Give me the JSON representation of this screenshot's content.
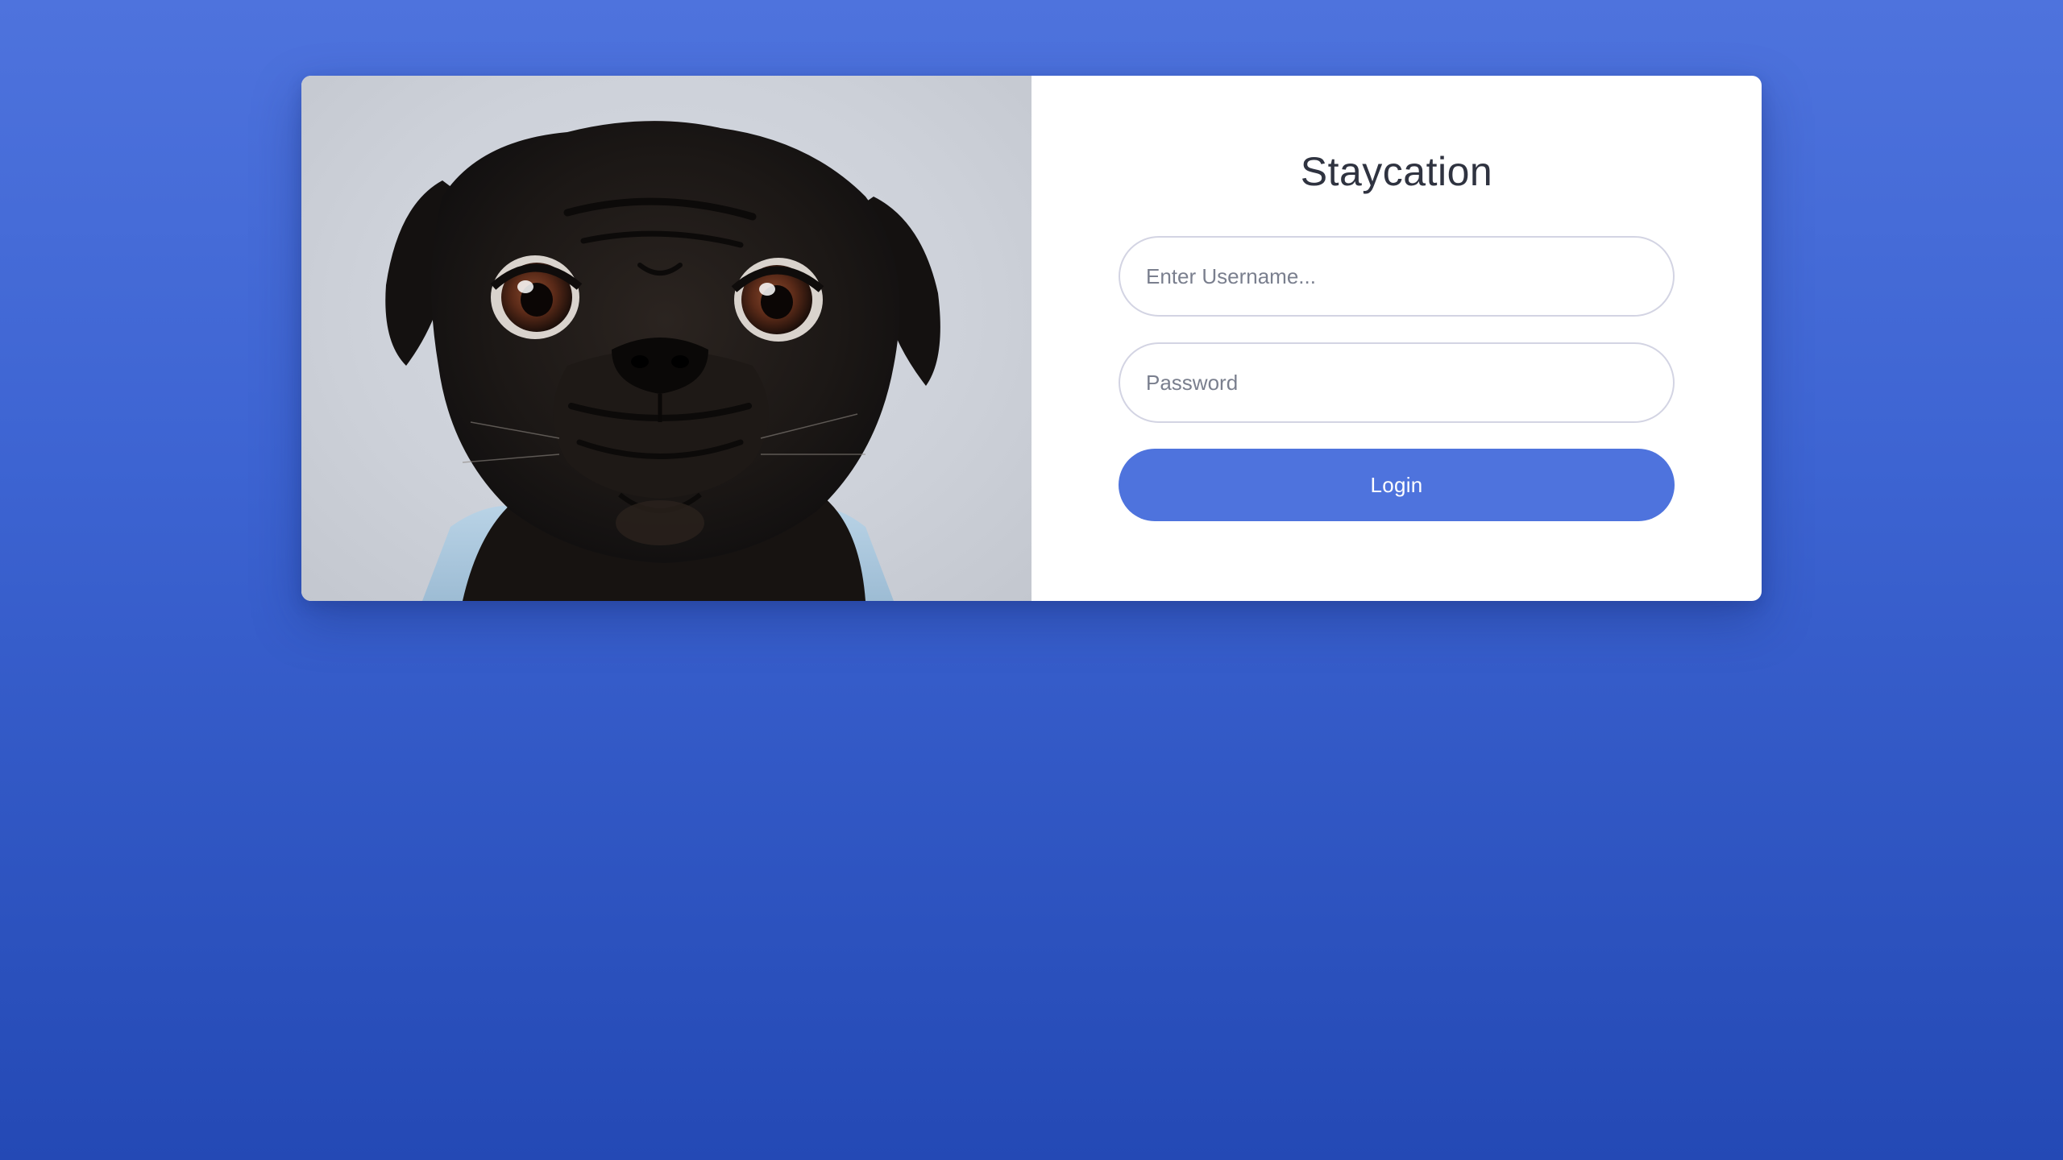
{
  "app": {
    "title": "Staycation"
  },
  "login": {
    "username_placeholder": "Enter Username...",
    "username_value": "",
    "password_placeholder": "Password",
    "password_value": "",
    "submit_label": "Login"
  },
  "image": {
    "subject": "pug-photo"
  },
  "colors": {
    "background_top": "#4e73dd",
    "background_bottom": "#2449b5",
    "accent": "#4e73dd",
    "card": "#ffffff",
    "field_border": "#d3d4e3",
    "title_text": "#2f3340"
  }
}
